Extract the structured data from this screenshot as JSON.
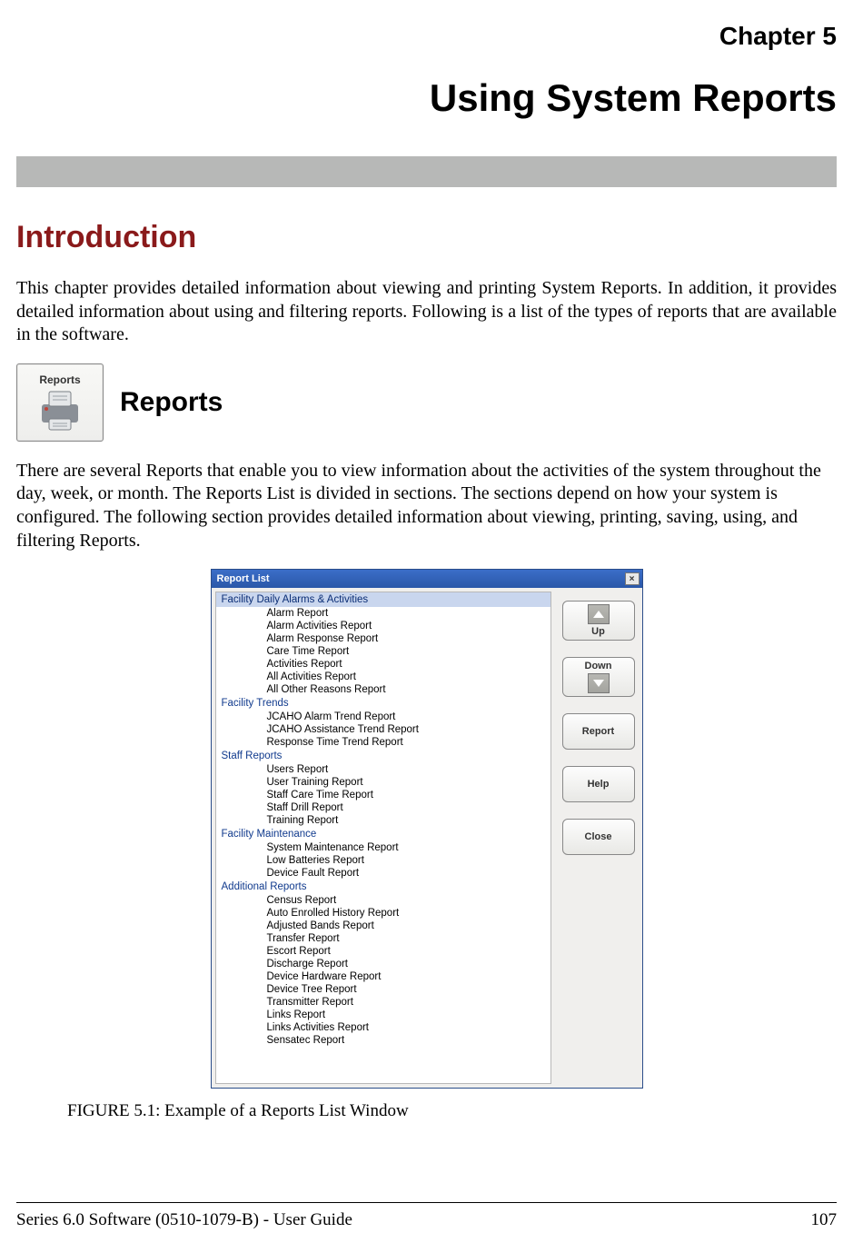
{
  "chapter": {
    "number_label": "Chapter 5",
    "title": "Using System Reports"
  },
  "intro": {
    "heading": "Introduction",
    "para": "This chapter provides detailed information about viewing and printing System Reports. In addition, it provides detailed information about using and filtering reports. Following is a list of the types of reports that are available in the software."
  },
  "reports": {
    "icon_label": "Reports",
    "heading": "Reports",
    "para": "There are several Reports that enable you to view information about the activities of the system throughout the day, week, or month. The Reports List is divided in sections. The sections depend on how your system is configured. The following section provides detailed information about viewing, printing, saving, using, and filtering Reports."
  },
  "report_list_window": {
    "title": "Report List",
    "close_glyph": "×",
    "sections": [
      {
        "header": "Facility Daily Alarms & Activities",
        "selected": true,
        "items": [
          "Alarm Report",
          "Alarm Activities Report",
          "Alarm Response Report",
          "Care Time Report",
          "Activities Report",
          "All Activities Report",
          "All Other Reasons Report"
        ]
      },
      {
        "header": "Facility Trends",
        "selected": false,
        "items": [
          "JCAHO Alarm Trend Report",
          "JCAHO Assistance Trend Report",
          "Response Time Trend Report"
        ]
      },
      {
        "header": "Staff Reports",
        "selected": false,
        "items": [
          "Users Report",
          "User Training Report",
          "Staff Care Time Report",
          "Staff Drill Report",
          "Training Report"
        ]
      },
      {
        "header": "Facility Maintenance",
        "selected": false,
        "items": [
          "System Maintenance Report",
          "Low Batteries Report",
          "Device Fault Report"
        ]
      },
      {
        "header": "Additional Reports",
        "selected": false,
        "items": [
          "Census Report",
          "Auto Enrolled History Report",
          "Adjusted Bands Report",
          "Transfer Report",
          "Escort Report",
          "Discharge Report",
          "Device Hardware Report",
          "Device Tree Report",
          "Transmitter Report",
          "Links Report",
          "Links Activities Report",
          "Sensatec Report"
        ]
      }
    ],
    "buttons": {
      "up": "Up",
      "down": "Down",
      "report": "Report",
      "help": "Help",
      "close": "Close"
    }
  },
  "figure_caption": "FIGURE 5.1:    Example of a Reports List Window",
  "footer": {
    "left": "Series 6.0 Software (0510-1079-B) - User Guide",
    "right": "107"
  }
}
